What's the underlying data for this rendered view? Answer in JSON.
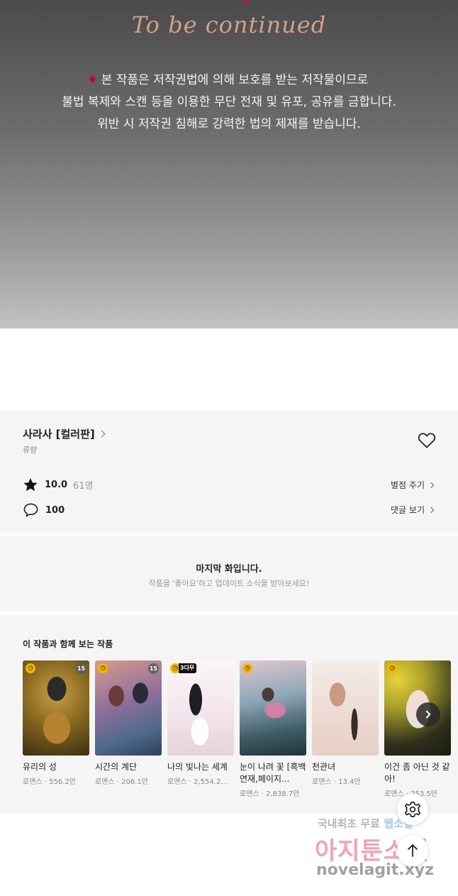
{
  "end_banner": {
    "continued_text": "To be continued",
    "notice_lines": [
      "본 작품은 저작권법에 의해 보호를 받는 저작물이므로",
      "불법 복제와 스캔 등을 이용한 무단 전재 및 유포, 공유를 금합니다.",
      "위반 시 저작권 침해로 강력한 법의 제재를 받습니다."
    ]
  },
  "work": {
    "title": "사라사 [컬러판]",
    "author": "류량",
    "rating": "10.0",
    "rating_count": "61명",
    "comment_count": "100",
    "rate_link": "별점 주기",
    "comments_link": "댓글 보기"
  },
  "last_episode": {
    "title": "마지막 화입니다.",
    "subtitle": "작품을 '좋아요'하고 업데이트 소식을 받아보세요!"
  },
  "recommendations": {
    "heading": "이 작품과 함께 보는 작품",
    "items": [
      {
        "title": "유리의 성",
        "meta": "로맨스 · 556.2만",
        "badge": "clock",
        "age": "15"
      },
      {
        "title": "시간의 계단",
        "meta": "로맨스 · 206.1만",
        "badge": "clock",
        "age": "15"
      },
      {
        "title": "나의 빛나는 세계",
        "meta": "로맨스 · 2,554.2...",
        "badge": "3다무",
        "age": ""
      },
      {
        "title": "눈이 나려 꽃 [흑백연재,페이지...",
        "meta": "로맨스 · 2,838.7만",
        "badge": "clock",
        "age": ""
      },
      {
        "title": "천관녀",
        "meta": "로맨스 · 13.4만",
        "badge": "",
        "age": ""
      },
      {
        "title": "이건 좀 아닌 것 같아!",
        "meta": "로맨스 · 253.5만",
        "badge": "clock",
        "age": ""
      }
    ]
  },
  "watermark": {
    "line1_a": "국내최초 무료",
    "line1_b": "웹소설",
    "line2": "아지툰소설",
    "line3": "novelagit.xyz"
  },
  "colors": {
    "badge_yellow": "#f5b800",
    "notice_red": "#d0021b",
    "panel_bg": "#f5f5f5"
  }
}
